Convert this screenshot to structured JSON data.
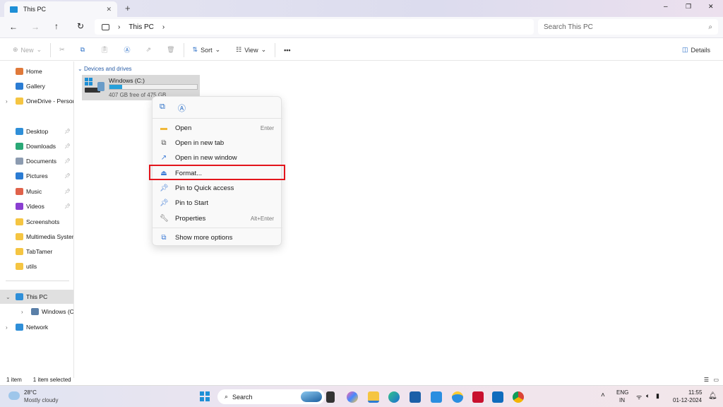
{
  "window": {
    "tab_title": "This PC",
    "new_tab": "+",
    "controls": [
      "–",
      "❐",
      "✕"
    ]
  },
  "address": {
    "crumbs": [
      "This PC"
    ],
    "search_placeholder": "Search This PC"
  },
  "toolbar": {
    "new": "New",
    "sort": "Sort",
    "view": "View",
    "more": "•••",
    "details": "Details"
  },
  "sidebar": {
    "items": [
      {
        "label": "Home",
        "icon": "home-icon",
        "color": "#e0793a"
      },
      {
        "label": "Gallery",
        "icon": "gallery-icon",
        "color": "#2b7cd3"
      },
      {
        "label": "OneDrive - Persona",
        "icon": "folder-icon",
        "color": "#f5c542",
        "expand": true
      },
      {
        "label": "Desktop",
        "icon": "desktop-icon",
        "color": "#2f8fd8",
        "pinned": true
      },
      {
        "label": "Downloads",
        "icon": "download-icon",
        "color": "#2aa876",
        "pinned": true
      },
      {
        "label": "Documents",
        "icon": "document-icon",
        "color": "#8c9bb0",
        "pinned": true
      },
      {
        "label": "Pictures",
        "icon": "pictures-icon",
        "color": "#2b7cd3",
        "pinned": true
      },
      {
        "label": "Music",
        "icon": "music-icon",
        "color": "#e0624b",
        "pinned": true
      },
      {
        "label": "Videos",
        "icon": "videos-icon",
        "color": "#8a3fd1",
        "pinned": true
      },
      {
        "label": "Screenshots",
        "icon": "folder-icon",
        "color": "#f5c542"
      },
      {
        "label": "Multimedia System",
        "icon": "folder-icon",
        "color": "#f5c542"
      },
      {
        "label": "TabTamer",
        "icon": "folder-icon",
        "color": "#f5c542"
      },
      {
        "label": "utils",
        "icon": "folder-icon",
        "color": "#f5c542"
      },
      {
        "label": "This PC",
        "icon": "pc-icon",
        "color": "#2f8fd8",
        "expanded": true,
        "selected": true
      },
      {
        "label": "Windows (C:)",
        "icon": "drive-icon",
        "color": "#5a7fa8",
        "expand": true
      },
      {
        "label": "Network",
        "icon": "network-icon",
        "color": "#2f8fd8",
        "expand": true
      }
    ]
  },
  "main": {
    "section": "Devices and drives",
    "drive": {
      "name": "Windows (C:)",
      "free": "407 GB free of 475 GB",
      "used_fraction": 0.143
    }
  },
  "context_menu": {
    "items": [
      {
        "label": "Open",
        "shortcut": "Enter",
        "icon": "folder-icon"
      },
      {
        "label": "Open in new tab",
        "shortcut": "",
        "icon": "new-tab-icon"
      },
      {
        "label": "Open in new window",
        "shortcut": "",
        "icon": "new-window-icon"
      },
      {
        "label": "Format...",
        "shortcut": "",
        "icon": "format-icon"
      },
      {
        "label": "Pin to Quick access",
        "shortcut": "",
        "icon": "pin-icon"
      },
      {
        "label": "Pin to Start",
        "shortcut": "",
        "icon": "pin-icon"
      },
      {
        "label": "Properties",
        "shortcut": "Alt+Enter",
        "icon": "wrench-icon"
      }
    ],
    "more": "Show more options",
    "highlight_color": "#e3151c"
  },
  "status": {
    "count": "1 item",
    "selected": "1 item selected"
  },
  "taskbar": {
    "temp": "28°C",
    "weather": "Mostly cloudy",
    "search": "Search",
    "lang1": "ENG",
    "lang2": "IN",
    "time": "11:55",
    "date": "01-12-2024"
  }
}
